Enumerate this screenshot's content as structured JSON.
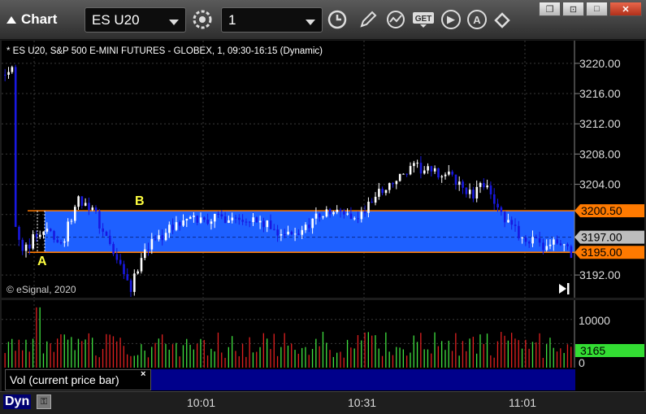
{
  "window": {
    "title": "Chart",
    "symbol": "ES U20",
    "interval": "1",
    "buttons": {
      "restore": "❐",
      "snap": "⊡",
      "maximize": "□",
      "close": "✕"
    }
  },
  "toolbar_icons": [
    "gear-icon",
    "clock-icon",
    "pencil-icon",
    "study-icon",
    "get-icon",
    "play-icon",
    "alert-icon",
    "link-icon"
  ],
  "chart": {
    "header": "* ES U20, S&P 500 E-MINI FUTURES - GLOBEX, 1, 09:30-16:15 (Dynamic)",
    "copyright": "© eSignal, 2020",
    "price_axis": [
      "3220.00",
      "3216.00",
      "3212.00",
      "3208.00",
      "3204.00",
      "3192.00"
    ],
    "time_axis": [
      "10:01",
      "10:31",
      "11:01"
    ],
    "marker_a": "A",
    "marker_b": "B",
    "line_high_label": "3200.50",
    "last_price_label": "3197.00",
    "line_low_label": "3195.00",
    "colors": {
      "up": "#ffffff",
      "down": "#1818e0",
      "box": "#1e60ff",
      "line": "#ff7a00",
      "marker": "#ffff40"
    }
  },
  "volume": {
    "label": "Vol (current price bar)",
    "close": "×",
    "axis": [
      "10000",
      "0"
    ],
    "last_label": "3165",
    "colors": {
      "up": "#40e040",
      "down": "#e02020"
    }
  },
  "footer": {
    "dyn": "Dyn"
  },
  "chart_data": {
    "type": "bar",
    "price_range": [
      3189.0,
      3223.0
    ],
    "volume_range": [
      0,
      14000
    ]
  }
}
